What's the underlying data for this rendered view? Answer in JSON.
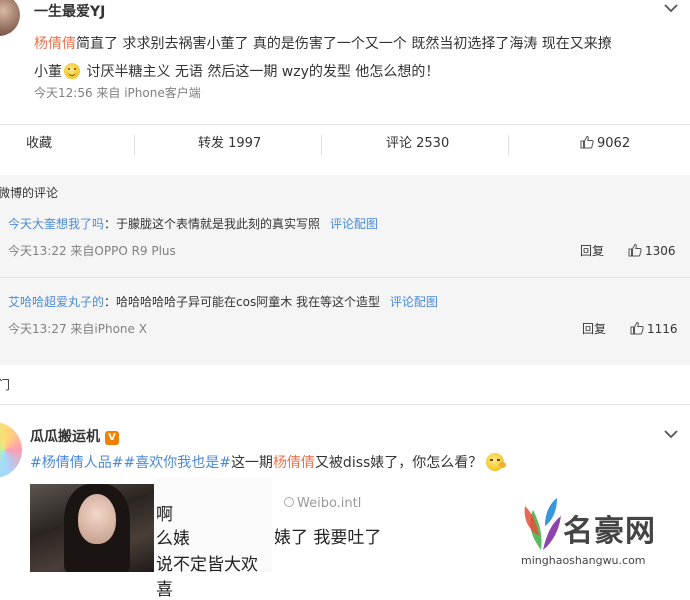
{
  "post1": {
    "username": "一生最爱YJ",
    "mention": "杨倩倩",
    "text_part1": "简直了 求求别去祸害小董了 真的是伤害了一个又一个 既然当初选择了海涛 现在又来撩",
    "text_part2": "小董",
    "text_part3": "讨厌半糖主义 无语 然后这一期 wzy的发型 他怎么想的！",
    "meta": "今天12:56 来自 iPhone客户端"
  },
  "actions": {
    "favorite": "收藏",
    "repost": "转发 1997",
    "comment": "评论 2530",
    "likes": "9062"
  },
  "comments": {
    "title": "微博的评论",
    "items": [
      {
        "user": "今天大奎想我了吗",
        "colon": "：",
        "text": "于朦胧这个表情就是我此刻的真实写照",
        "link": "评论配图",
        "meta": "今天13:22 来自OPPO R9 Plus",
        "reply": "回复",
        "likes": "1306"
      },
      {
        "user": "艾哈哈超爱丸子的",
        "colon": "：",
        "text": "哈哈哈哈哈子异可能在cos阿童木 我在等这个造型",
        "link": "评论配图",
        "meta": "今天13:27 来自iPhone X",
        "reply": "回复",
        "likes": "1116"
      }
    ]
  },
  "side_char": "门",
  "post2": {
    "username": "瓜瓜搬运机",
    "verified_badge": "V",
    "topic1": "#杨倩倩人品#",
    "topic2": "#喜欢你我也是#",
    "text_a": "这一期",
    "mention": "杨倩倩",
    "text_b": "又被diss婊了，你怎么看？",
    "image_text_left": [
      "啊",
      "么婊",
      "说不定皆大欢喜"
    ],
    "image_watermark": "Weibo.intl",
    "image_text_right": "婊了 我要吐了"
  },
  "watermark": {
    "name": "名豪网",
    "url": "minghaoshangwu.com"
  },
  "colors": {
    "mention": "#eb7350",
    "link": "#4a8ad6",
    "badge": "#f08000",
    "comment_bg": "#f5f5f5"
  }
}
